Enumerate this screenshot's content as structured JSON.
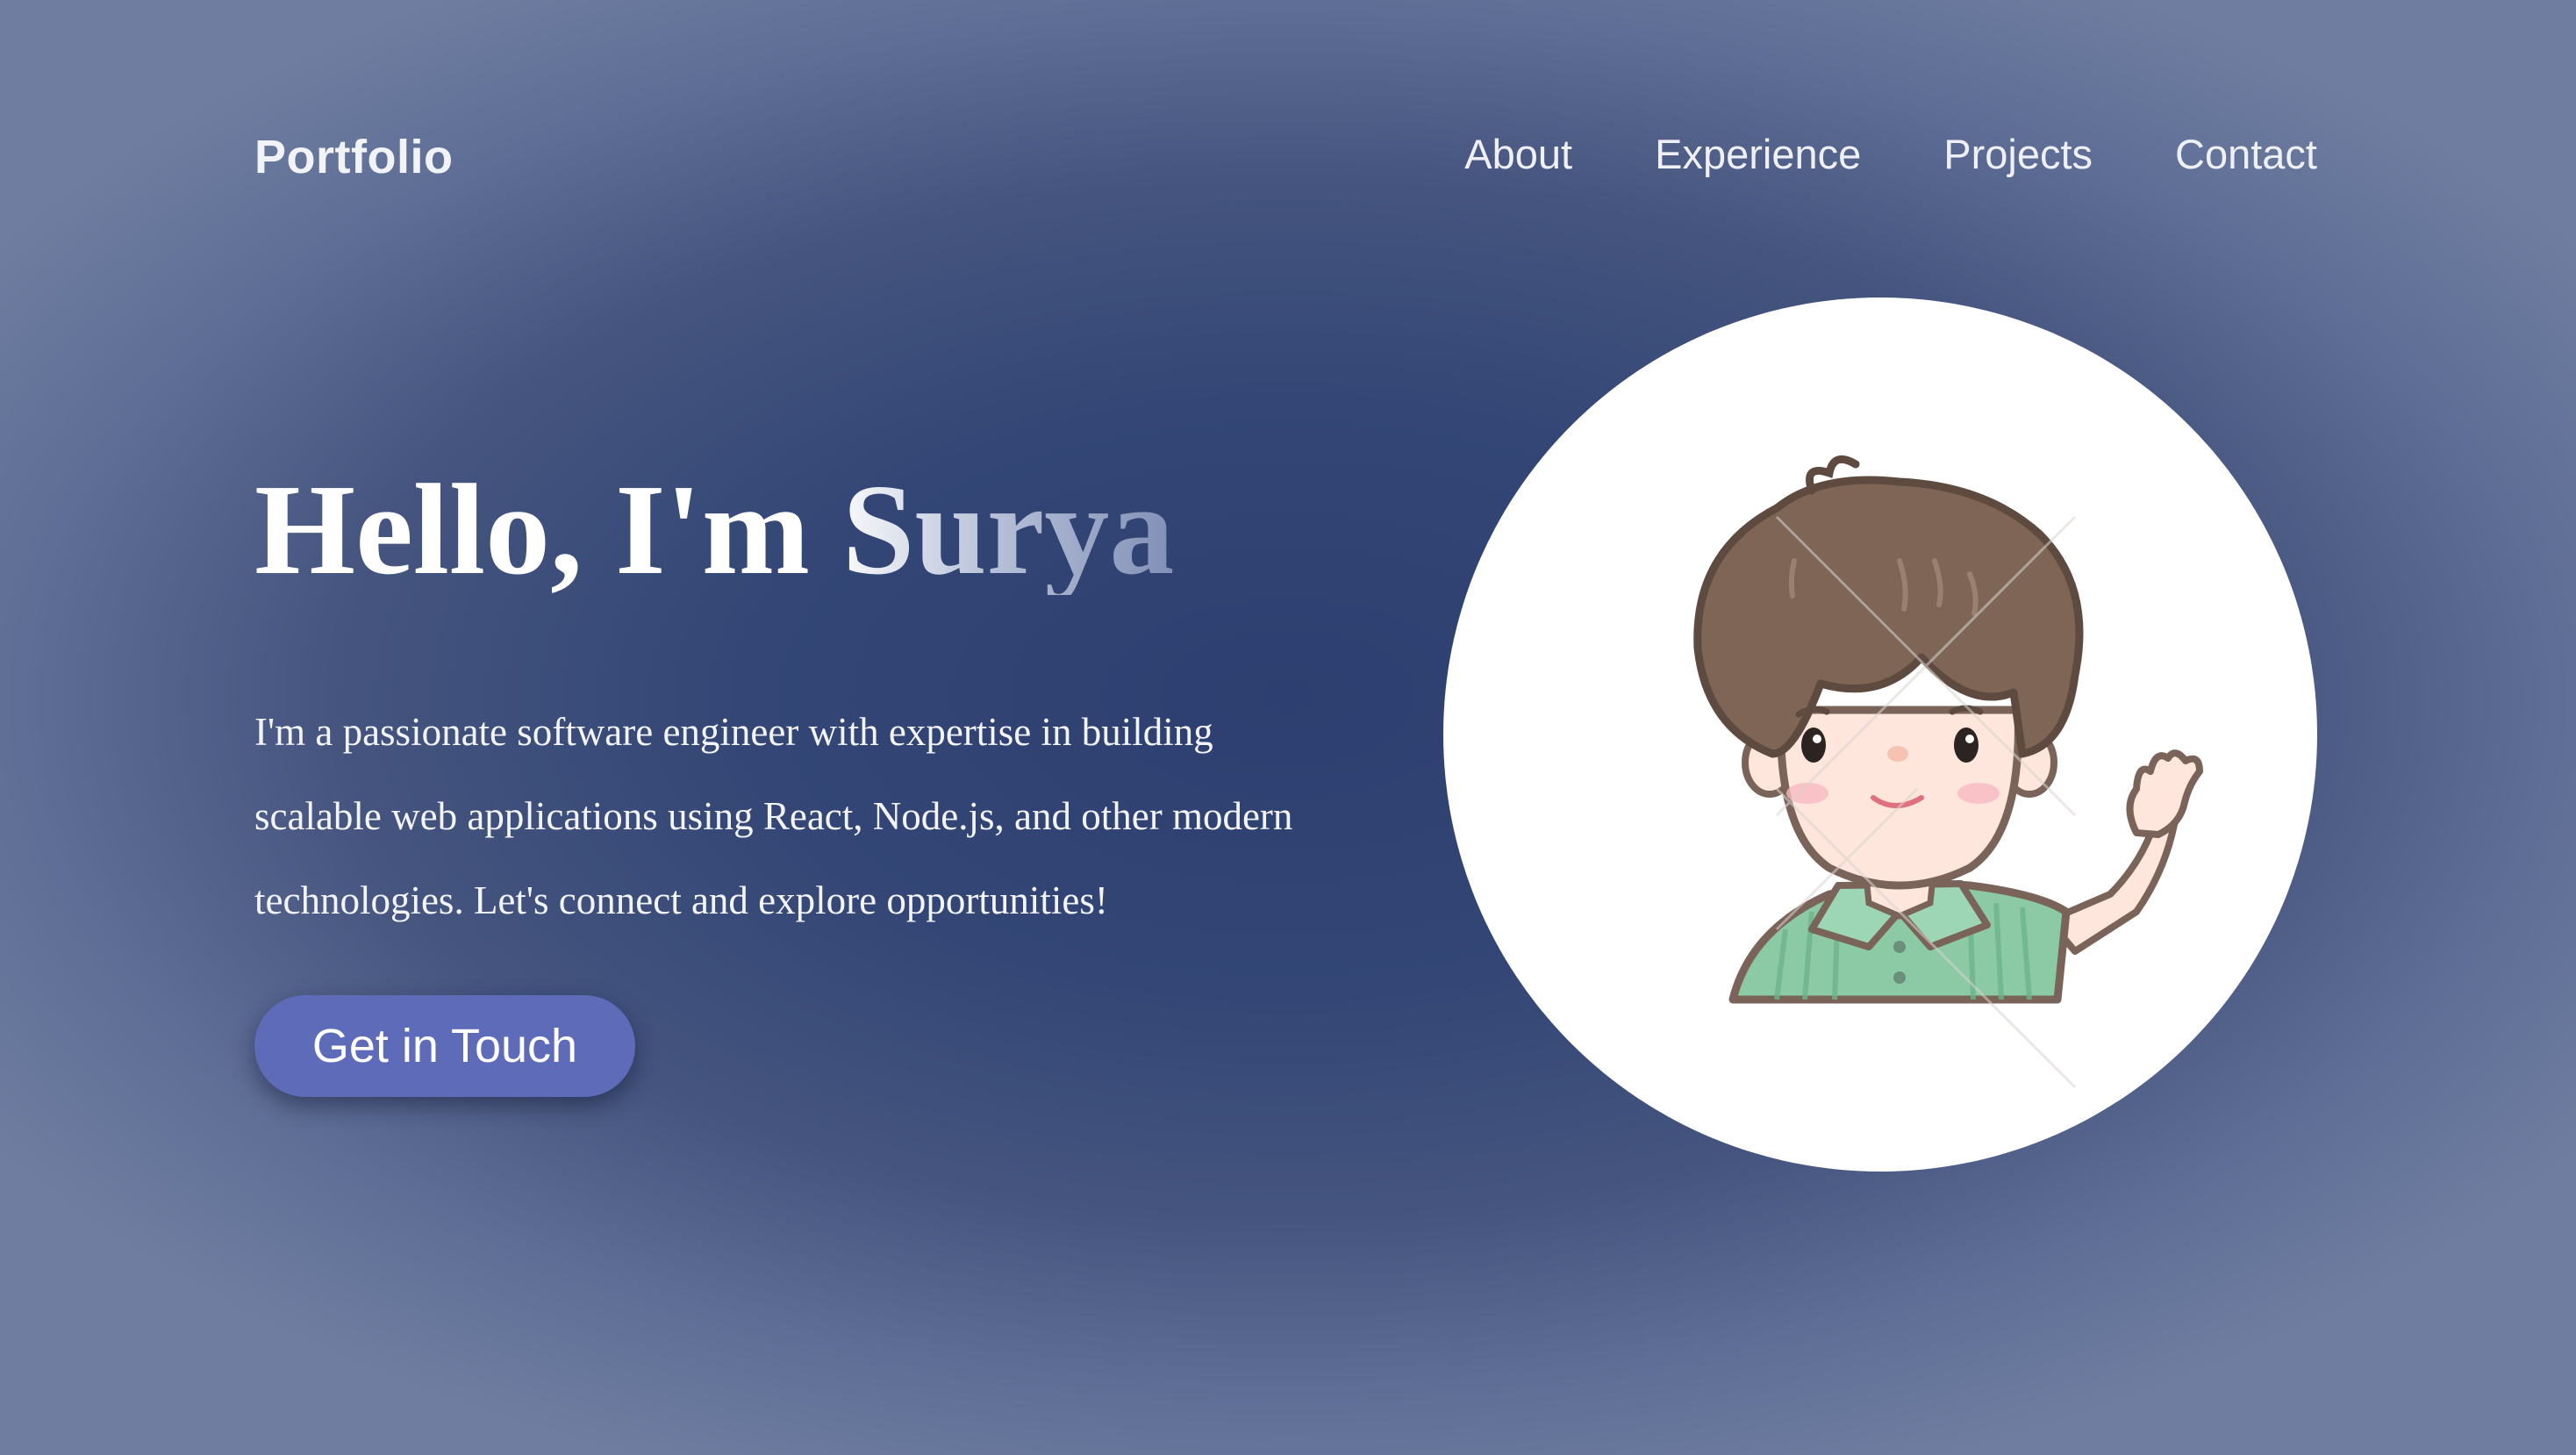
{
  "header": {
    "logo": "Portfolio",
    "nav": [
      {
        "label": "About"
      },
      {
        "label": "Experience"
      },
      {
        "label": "Projects"
      },
      {
        "label": "Contact"
      }
    ]
  },
  "hero": {
    "headline": "Hello, I'm Surya",
    "intro": "I'm a passionate software engineer with expertise in building scalable web applications using React, Node.js, and other modern technologies. Let's connect and explore opportunities!",
    "cta_label": "Get in Touch"
  },
  "avatar": {
    "icon": "cartoon-boy-waving-illustration"
  },
  "colors": {
    "accent": "#5d6bb9",
    "background_center": "#2d3f70",
    "background_edge": "#6f7ea0"
  }
}
